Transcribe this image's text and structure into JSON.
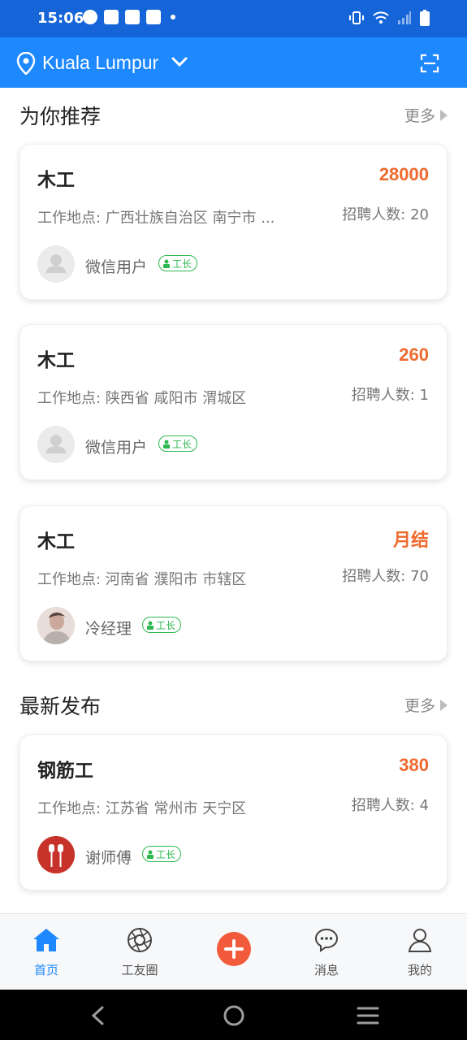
{
  "status": {
    "time": "15:06"
  },
  "location": {
    "city": "Kuala Lumpur"
  },
  "sections": {
    "recommended": {
      "title": "为你推荐",
      "more": "更多"
    },
    "latest": {
      "title": "最新发布",
      "more": "更多"
    }
  },
  "jobs": [
    {
      "title": "木工",
      "pay": "28000",
      "location": "工作地点: 广西壮族自治区 南宁市 ...",
      "hire": "招聘人数: 20",
      "user": "微信用户",
      "badge": "工长"
    },
    {
      "title": "木工",
      "pay": "260",
      "location": "工作地点: 陕西省 咸阳市 渭城区",
      "hire": "招聘人数: 1",
      "user": "微信用户",
      "badge": "工长"
    },
    {
      "title": "木工",
      "pay": "月结",
      "location": "工作地点: 河南省 濮阳市 市辖区",
      "hire": "招聘人数: 70",
      "user": "冷经理",
      "badge": "工长"
    }
  ],
  "latest_jobs": [
    {
      "title": "钢筋工",
      "pay": "380",
      "location": "工作地点: 江苏省 常州市 天宁区",
      "hire": "招聘人数: 4",
      "user": "谢师傅",
      "badge": "工长"
    }
  ],
  "nav": {
    "home": "首页",
    "circle": "工友圈",
    "messages": "消息",
    "mine": "我的"
  },
  "colors": {
    "primary": "#1e88ff",
    "pay": "#ee6a2e",
    "badge": "#2eb84f",
    "fab": "#f15a3a"
  }
}
